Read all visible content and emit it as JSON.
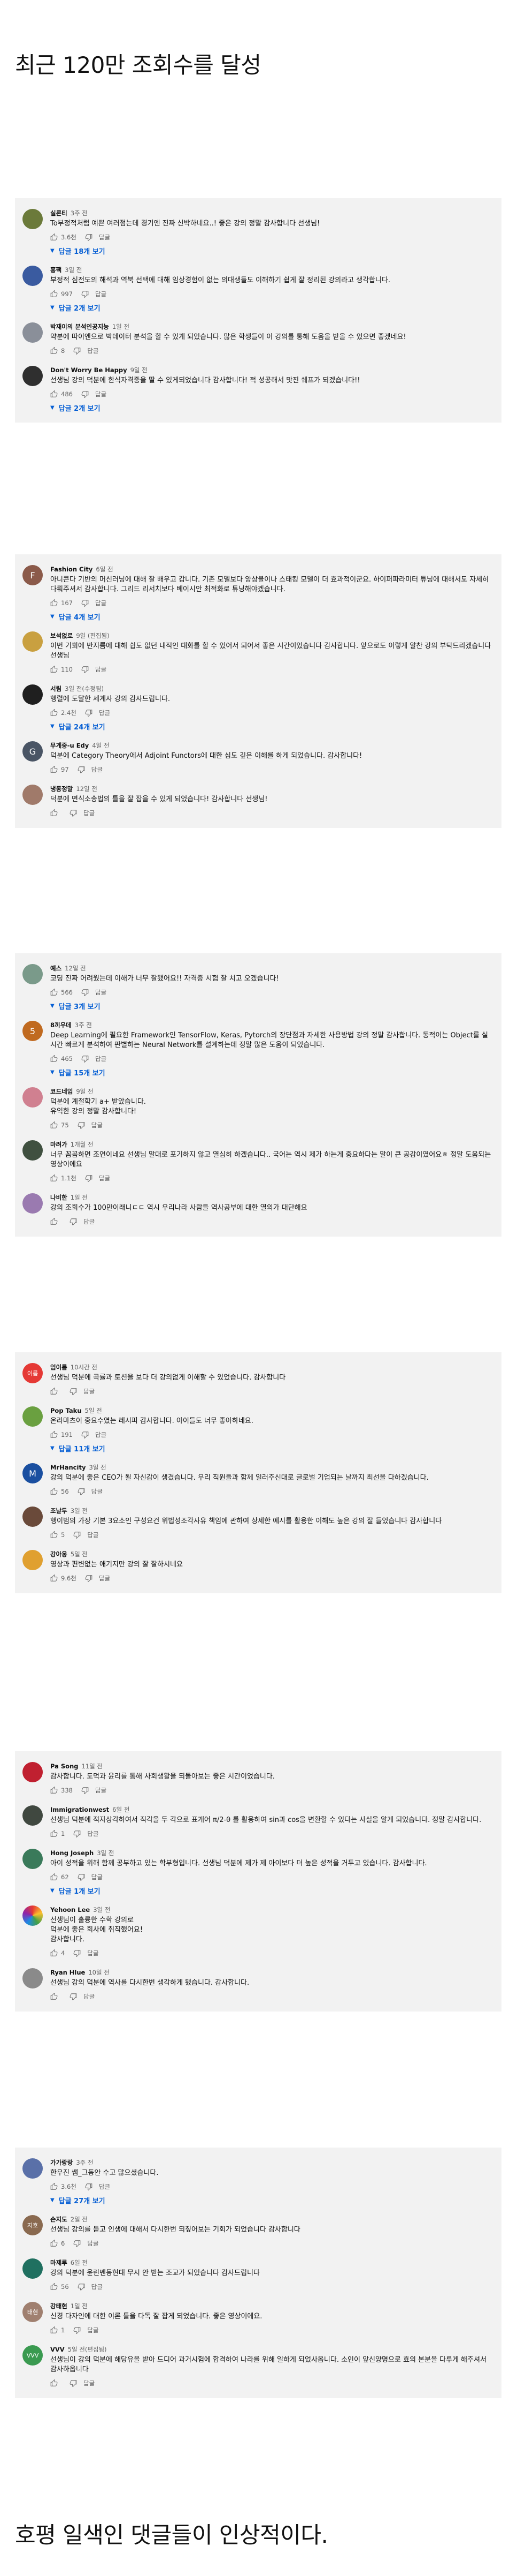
{
  "captions": {
    "top": "최근 120만 조회수를 달성",
    "bottom": "호평 일색인 댓글들이 인상적이다."
  },
  "reply_label": "답글",
  "panels": [
    {
      "comments": [
        {
          "author": "실론티",
          "time": "3주 전",
          "text": "To부정적처럼 예쁜 여러점는데 경기엔 진짜 신박하네요..! 좋은 강의 정말 감사합니다 선생님!",
          "likes": "3.6천",
          "replies": "답글 18개 보기",
          "avatar_color": "#6b7a3a",
          "avatar_char": ""
        },
        {
          "author": "홍팩",
          "time": "3일 전",
          "text": "부정적 심전도의 해석과 역북 선택에 대해 임상경험이 없는 의대생들도 이해하기 쉽게 잘 정리된 강의라고 생각합니다.",
          "likes": "997",
          "replies": "답글 2개 보기",
          "avatar_color": "#3a5ba0",
          "avatar_char": ""
        },
        {
          "author": "박재이의 분석인공지능",
          "time": "1일 전",
          "text": "약분에 따이엔으로 박데이터 분석을 할 수 있게 되었습니다. 많은 학생들이 이 강의를 통해 도움을 받을 수 있으면 좋겠네요!",
          "likes": "8",
          "replies": "",
          "avatar_color": "#8a8f99",
          "avatar_char": ""
        },
        {
          "author": "Don't Worry Be Happy",
          "time": "9일 전",
          "text": "선생님 강의 덕분에 한식자격증을 딸 수 있게되었습니다 감사합니다! 적 성공해서 맛진 쉐프가 되겠습니다!!",
          "likes": "486",
          "replies": "답글 2개 보기",
          "avatar_color": "#2f2f2f",
          "avatar_char": ""
        }
      ]
    },
    {
      "comments": [
        {
          "author": "Fashion City",
          "time": "6일 전",
          "text": "아니콘다 기반의 머신러닝에 대해 잘 배우고 갑니다. 기존 모델보다 양상블이나 스태킹 모델이 더 효과적이군요. 하이퍼파라미터 튜닝에 대해서도 자세히 다뤄주셔서 감사합니다. 그리드 리서치보다 베이시안 최적화로 튜닝해야겠습니다.",
          "likes": "167",
          "replies": "답글 4개 보기",
          "avatar_color": "#8b5a4a",
          "avatar_char": "F"
        },
        {
          "author": "보석없로",
          "time": "9일 (편집됨)",
          "text": "이번 기회에 반지름에 대해 쉽도 없던 내적인 대화를 할 수 있어서 되어서 좋은 시간이었습니다 감사합니다. 앞으로도 이렇게 알찬 강의 부탁드리겠습니다 선생님",
          "likes": "110",
          "replies": "",
          "avatar_color": "#c9a040",
          "avatar_char": ""
        },
        {
          "author": "서림",
          "time": "3일 전(수정됨)",
          "text": "행렬에 도달한 세계사 강의 감사드립니다.",
          "likes": "2.4천",
          "replies": "답글 24개 보기",
          "avatar_color": "#1f1f1f",
          "avatar_char": ""
        },
        {
          "author": "무게중-u Edy",
          "time": "4일 전",
          "text": "덕분에 Category Theory에서 Adjoint Functors에 대한 심도 깊은 이해를 하게 되었습니다. 감사합니다!",
          "likes": "97",
          "replies": "",
          "avatar_color": "#4a5565",
          "avatar_char": "G"
        },
        {
          "author": "냉동정말",
          "time": "12일 전",
          "text": "덕분에 면식소송법의 틀을 잘 잡을 수 있게 되었습니다! 감사합니다 선생님!",
          "likes": "",
          "replies": "",
          "avatar_color": "#a07a6a",
          "avatar_char": ""
        }
      ]
    },
    {
      "comments": [
        {
          "author": "예스",
          "time": "12일 전",
          "text": "코딩 진짜 어려웠는데 이해가 너무 잘됐어요!! 자격증 시험 잘 치고 오겠습니다!",
          "likes": "566",
          "replies": "답글 3개 보기",
          "avatar_color": "#7a9a8a",
          "avatar_char": ""
        },
        {
          "author": "8끼우데",
          "time": "3주 전",
          "text": "Deep Learning에 필요한 Framework인 TensorFlow, Keras, Pytorch의 장단점과 자세한 사용방법 강의 정말 감사합니다. 동적이는 Object를 실시간 빠르게 분석하여 판별하는 Neural Network를 설계하는데 정말 많은 도움이 되었습니다.",
          "likes": "465",
          "replies": "답글 15개 보기",
          "avatar_color": "#c06a20",
          "avatar_char": "5"
        },
        {
          "author": "코드네임",
          "time": "9일 전",
          "text": "덕분에 계절학기 a+ 받았습니다.\n유익한 강의 정말 감사합니다!",
          "likes": "75",
          "replies": "",
          "avatar_color": "#d08090",
          "avatar_char": ""
        },
        {
          "author": "마려가",
          "time": "1개월 전",
          "text": "너무 꼼꼼하면 조연이네요 선생님 말대로 포기하지 않고 열심히 하겠습니다.. 국어는 역시 제가 하는게 중요하다는 말이 큰 공감이였어요ㅎ 정말 도움되는 영상이에요",
          "likes": "1.1천",
          "replies": "",
          "avatar_color": "#405040",
          "avatar_char": ""
        },
        {
          "author": "나비한",
          "time": "1일 전",
          "text": "강의 조회수가 100만이래니ㄷㄷ 역시 우리나라 사람들 역사공부에 대한 열의가 대단해요",
          "likes": "",
          "replies": "",
          "avatar_color": "#9a7ab0",
          "avatar_char": ""
        }
      ]
    },
    {
      "comments": [
        {
          "author": "엄이름",
          "time": "10시간 전",
          "text": "선생님 덕분에 곡률과 토션을 보다 더 강의없게 이해할 수 있었습니다. 감사합니다",
          "likes": "",
          "replies": "",
          "avatar_color": "#e53935",
          "avatar_char": "이름"
        },
        {
          "author": "Pop Taku",
          "time": "5일 전",
          "text": "온라마츠이 중요수였는 레시피 감사합니다. 아이들도 너무 좋아하네요.",
          "likes": "191",
          "replies": "답글 11개 보기",
          "avatar_color": "#6aa040",
          "avatar_char": ""
        },
        {
          "author": "MrHancity",
          "time": "3일 전",
          "text": "강의 덕분에 좋은 CEO가 될 자신감이 생겼습니다. 우리 직원들과 함께 일러주신대로 글로벌 기업되는 날까지 최선을 다하겠습니다.",
          "likes": "56",
          "replies": "",
          "avatar_color": "#1a4fa0",
          "avatar_char": "M"
        },
        {
          "author": "조날두",
          "time": "3일 전",
          "text": "행이범의 가장 기본 3요소인 구성요건 위법성조각사유 책임에 관하여 상세한 예시를 활용한 이해도 높은 강의 잘 들었습니다 감사합니다",
          "likes": "5",
          "replies": "",
          "avatar_color": "#6a4a3a",
          "avatar_char": ""
        },
        {
          "author": "강아웅",
          "time": "5일 전",
          "text": "영상과 편변없는 애기지만 강의 잘 잘하시네요",
          "likes": "9.6천",
          "replies": "",
          "avatar_color": "#e0a030",
          "avatar_char": ""
        }
      ]
    },
    {
      "comments": [
        {
          "author": "Pa Song",
          "time": "11일 전",
          "text": "감사합니다. 도덕과 윤리를 통해 사회생활을 되돌아보는 좋은 시간이었습니다.",
          "likes": "338",
          "replies": "",
          "avatar_color": "#c02030",
          "avatar_char": ""
        },
        {
          "author": "Immigrationwest",
          "time": "6일 전",
          "text": "선생님 덕분에 적자상각하여서 직각을 두 각으로 표개어 π/2-θ 를 활용하여 sin과 cos을 변환할 수 있다는 사실을 알게 되었습니다. 정말 감사합니다.",
          "likes": "1",
          "replies": "",
          "avatar_color": "#404840",
          "avatar_char": ""
        },
        {
          "author": "Hong Joseph",
          "time": "3일 전",
          "text": "아이 성적을 위해 함께 공부하고 있는 학부형입니다. 선생님 덕분에 제가 제 아이보다 더 높은 성적을 거두고 있습니다. 감사합니다.",
          "likes": "62",
          "replies": "답글 1개 보기",
          "avatar_color": "#3a7a5a",
          "avatar_char": ""
        },
        {
          "author": "Yehoon Lee",
          "time": "3일 전",
          "text": "선생님이 훌륭한 수학 강의로\n덕분에 좋은 회사에 취직했어요!\n감사합니다.",
          "likes": "4",
          "replies": "",
          "avatar_color": "#ffffff",
          "avatar_char": ""
        },
        {
          "author": "Ryan Hlue",
          "time": "10일 전",
          "text": "선생님 강의 덕분에 역사를 다시한번 생각하게 됐습니다. 감사합니다.",
          "likes": "",
          "replies": "",
          "avatar_color": "#8a8a8a",
          "avatar_char": ""
        }
      ]
    },
    {
      "comments": [
        {
          "author": "가가랑랑",
          "time": "3주 전",
          "text": "한우진 쌤_그동안 수고 많으셨습니다.",
          "likes": "3.6천",
          "replies": "답글 27개 보기",
          "avatar_color": "#5a70a8",
          "avatar_char": ""
        },
        {
          "author": "손지도",
          "time": "2일 전",
          "text": "선생님 강의를 듣고 인생에 대해서 다시한번 되짚어보는 기회가 되었습니다 감사합니다",
          "likes": "6",
          "replies": "",
          "avatar_color": "#8a6a50",
          "avatar_char": "지호"
        },
        {
          "author": "마제루",
          "time": "6일 전",
          "text": "강의 덕분에 윤린벤동현대 무시 안 받는 조교가 되었습니다 감사드립니다",
          "likes": "56",
          "replies": "",
          "avatar_color": "#207060",
          "avatar_char": ""
        },
        {
          "author": "강태현",
          "time": "1일 전",
          "text": "신경 다자인에 대한 이론 틀을 다독 잘 잡게 되었습니다. 좋은 영상이에요.",
          "likes": "1",
          "replies": "",
          "avatar_color": "#a08070",
          "avatar_char": "태현"
        },
        {
          "author": "VVV",
          "time": "5일 전(편집됨)",
          "text": "선생님이 강의 덕분에 해당유을 받아 드디어 과거시험에 합격하여 나라를 위해 일하게 되었사옵니다.  소인이 앞신양명으로 효의 본분을 다루게 해주셔서 감사하옵니다",
          "likes": "",
          "replies": "",
          "avatar_color": "#3a9a50",
          "avatar_char": "VVV"
        }
      ]
    }
  ]
}
